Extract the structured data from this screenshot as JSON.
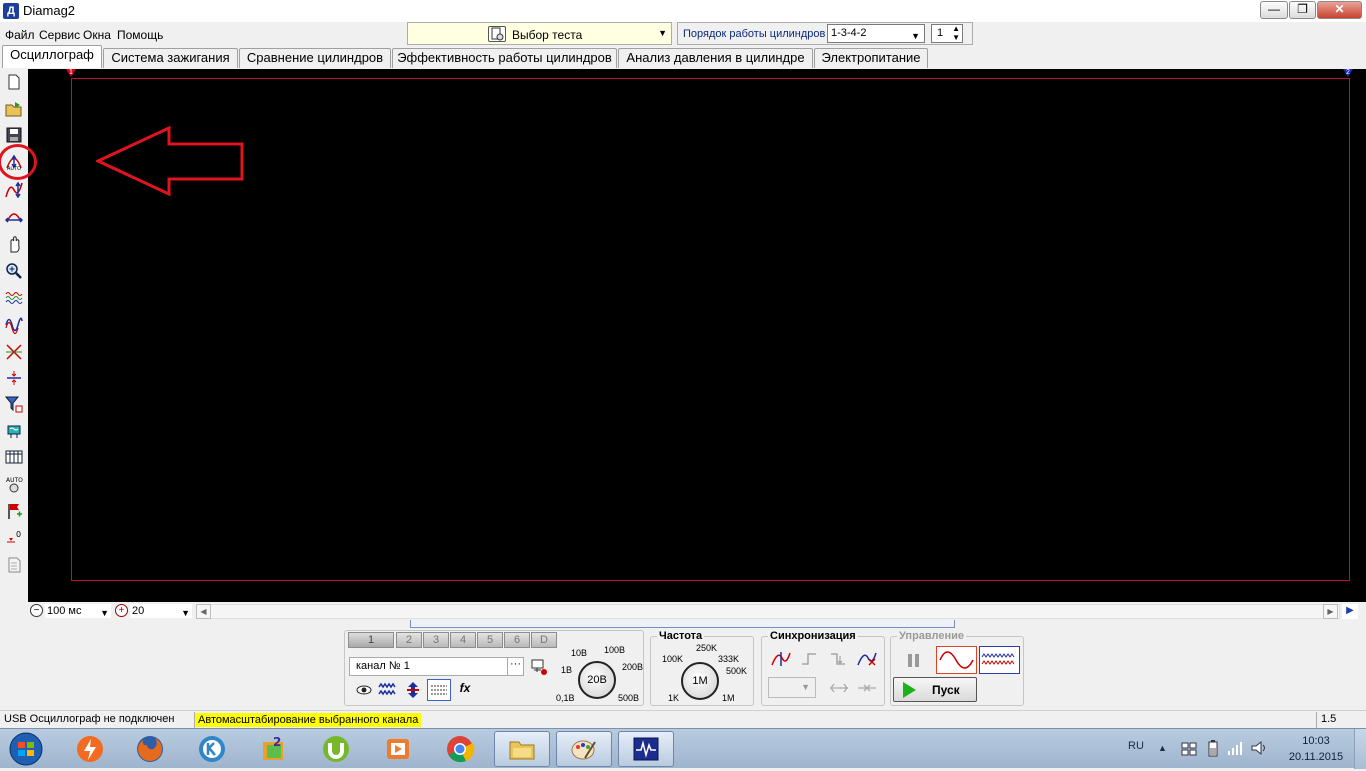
{
  "window": {
    "title": "Diamag2",
    "app_icon": "Д",
    "minimize": "—",
    "restore": "❐",
    "close": "✕"
  },
  "menu": [
    "Файл",
    "Сервис",
    "Окна",
    "Помощь"
  ],
  "test_select": {
    "label": "Выбор теста",
    "icon": "gear-document-icon"
  },
  "firing_order": {
    "label": "Порядок работы цилиндров",
    "value": "1-3-4-2",
    "cylinder": "1"
  },
  "tabs": [
    {
      "label": "Осциллограф",
      "active": true
    },
    {
      "label": "Система зажигания"
    },
    {
      "label": "Сравнение цилиндров"
    },
    {
      "label": "Эффективность работы цилиндров"
    },
    {
      "label": "Анализ давления в цилиндре"
    },
    {
      "label": "Электропитание"
    }
  ],
  "toolbar": [
    "new-file-icon",
    "open-folder-icon",
    "save-icon",
    "auto-scale-icon",
    "scale-signal-icon",
    "sync-level-icon",
    "hand-pan-icon",
    "zoom-icon",
    "waveforms-icon",
    "sine-compare-icon",
    "cross-measure-icon",
    "level-line-icon",
    "filter-icon",
    "device-icon",
    "grid-table-icon",
    "auto-settings-icon",
    "flag-marker-icon",
    "zero-offset-icon",
    "notes-icon"
  ],
  "scope": {
    "marker_left": "1",
    "marker_right": "2",
    "background": "#000000",
    "frame_color": "#c0103a",
    "annotation_color": "#e0141e"
  },
  "scale": {
    "time": "100 мс",
    "zoom": "20"
  },
  "channels": {
    "buttons": [
      "1",
      "2",
      "3",
      "4",
      "5",
      "6",
      "D"
    ],
    "selected": "1",
    "name": "канал № 1",
    "dots": "···",
    "fx": "fx"
  },
  "voltage_knob": {
    "ticks": [
      "10В",
      "100В",
      "1В",
      "200В",
      "0,1В",
      "500В"
    ],
    "value": "20В"
  },
  "frequency": {
    "title": "Частота",
    "ticks": [
      "250K",
      "100K",
      "333K",
      "500K",
      "1K",
      "1M"
    ],
    "value": "1M"
  },
  "sync": {
    "title": "Синхронизация"
  },
  "control": {
    "title": "Управление",
    "start": "Пуск"
  },
  "status": {
    "usb": "USB Осциллограф не подключен",
    "hint": "Автомасштабирование выбранного канала",
    "version": "1.5"
  },
  "taskbar": {
    "items": [
      "flash-app-icon",
      "firefox-icon",
      "k-app-icon",
      "lottery-icon",
      "utorrent-icon",
      "media-player-icon",
      "chrome-icon",
      "file-explorer-icon",
      "paint-icon",
      "diamag-icon"
    ],
    "lang": "RU",
    "time": "10:03",
    "date": "20.11.2015"
  }
}
